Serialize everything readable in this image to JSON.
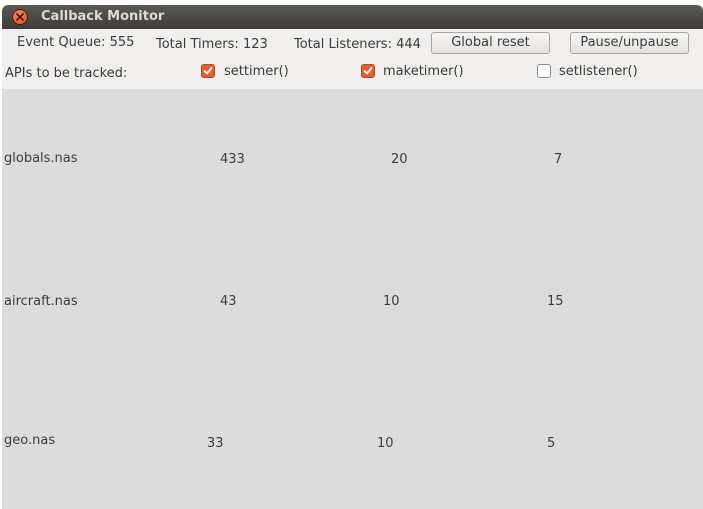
{
  "window": {
    "title": "Callback Monitor"
  },
  "stats": {
    "event_queue": "Event Queue: 555",
    "total_timers": "Total Timers: 123",
    "total_listeners": "Total Listeners: 444"
  },
  "buttons": {
    "global_reset": "Global reset",
    "pause": "Pause/unpause"
  },
  "apis": {
    "label": "APIs to be tracked:",
    "items": [
      {
        "label": "settimer()",
        "checked": true
      },
      {
        "label": "maketimer()",
        "checked": true
      },
      {
        "label": "setlistener()",
        "checked": false
      }
    ]
  },
  "rows": [
    {
      "file": "globals.nas",
      "c1": "433",
      "c2": "20",
      "c3": "7"
    },
    {
      "file": "aircraft.nas",
      "c1": "43",
      "c2": "10",
      "c3": "15"
    },
    {
      "file": "geo.nas",
      "c1": "33",
      "c2": "10",
      "c3": "5"
    }
  ],
  "colors": {
    "accent": "#e0612f",
    "titlebar": "#3d3c38",
    "content_bg": "#dcdcdc"
  }
}
